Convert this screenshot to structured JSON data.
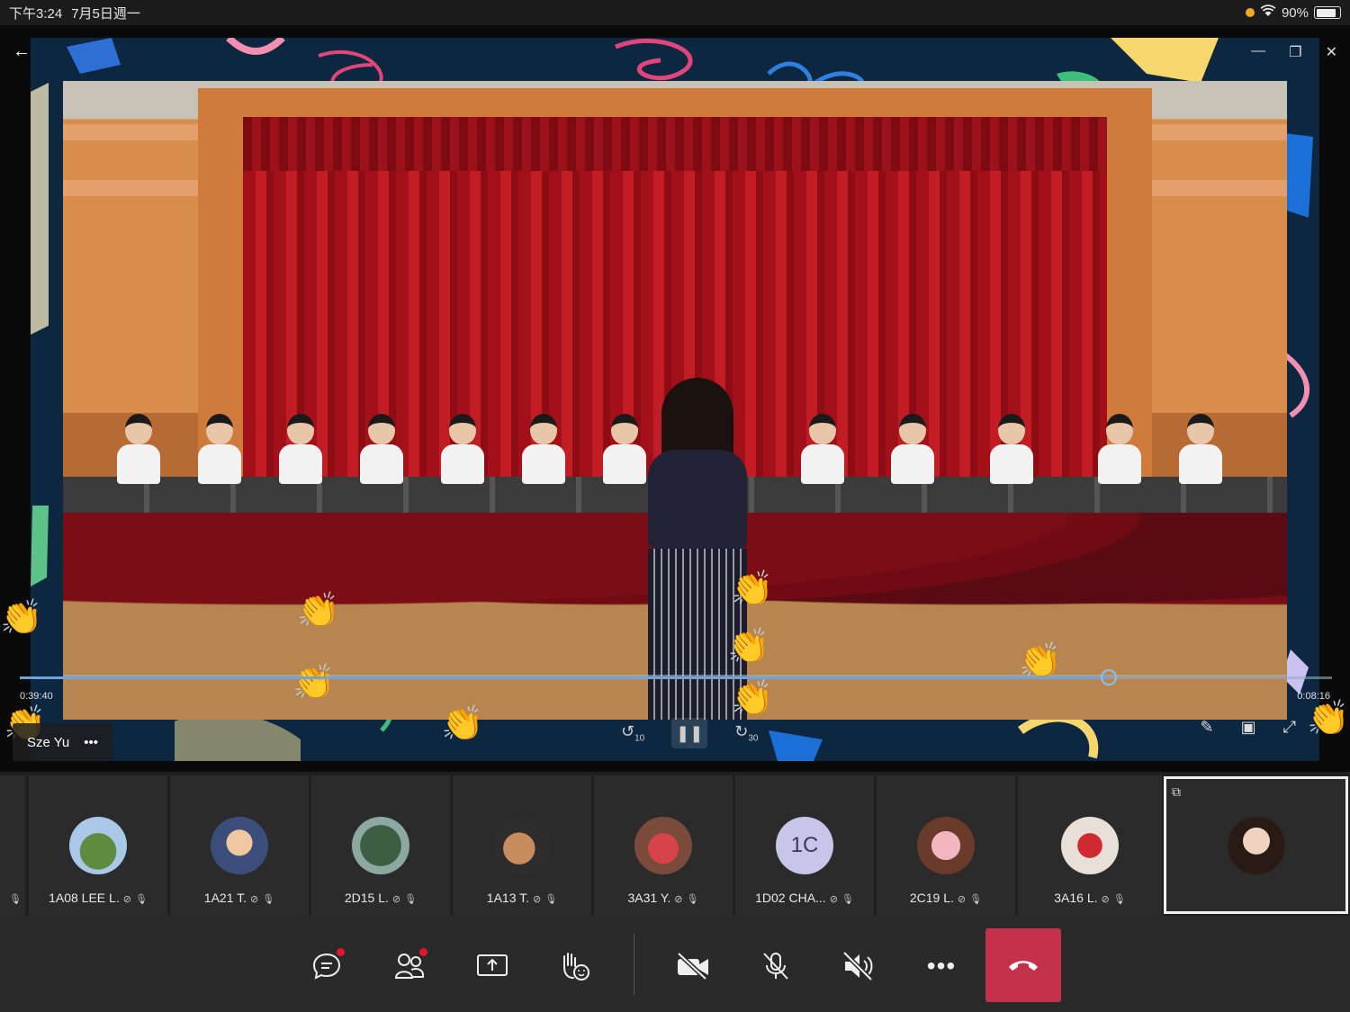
{
  "status_bar": {
    "time": "下午3:24",
    "date": "7月5日週一",
    "battery_text": "90%",
    "battery_level": 0.9,
    "wifi_icon": "wifi-icon"
  },
  "player": {
    "elapsed": "0:39:40",
    "remaining": "0:08:16",
    "progress_fraction": 0.83,
    "rewind_label": "10",
    "forward_label": "30"
  },
  "presenter": {
    "name": "Sze Yu",
    "more": "•••"
  },
  "participants": [
    {
      "name": "1A08 LEE L."
    },
    {
      "name": "1A21 T."
    },
    {
      "name": "2D15 L."
    },
    {
      "name": "1A13 T."
    },
    {
      "name": "3A31 Y."
    },
    {
      "name": "1D02 CHA...",
      "initials": "1C"
    },
    {
      "name": "2C19 L."
    },
    {
      "name": "3A16 L."
    }
  ],
  "controls": {
    "chat_icon": "chat-icon",
    "people_icon": "people-icon",
    "share_icon": "share-screen-icon",
    "reactions_icon": "raise-hand-icon",
    "camera_off_icon": "camera-off-icon",
    "mic_off_icon": "mic-off-icon",
    "speaker_off_icon": "speaker-off-icon",
    "more": "•••",
    "hangup_icon": "hang-up-icon"
  },
  "colors": {
    "hangup": "#c4314b",
    "notification_dot": "#e0162b",
    "progress": "#6fa3d9"
  }
}
